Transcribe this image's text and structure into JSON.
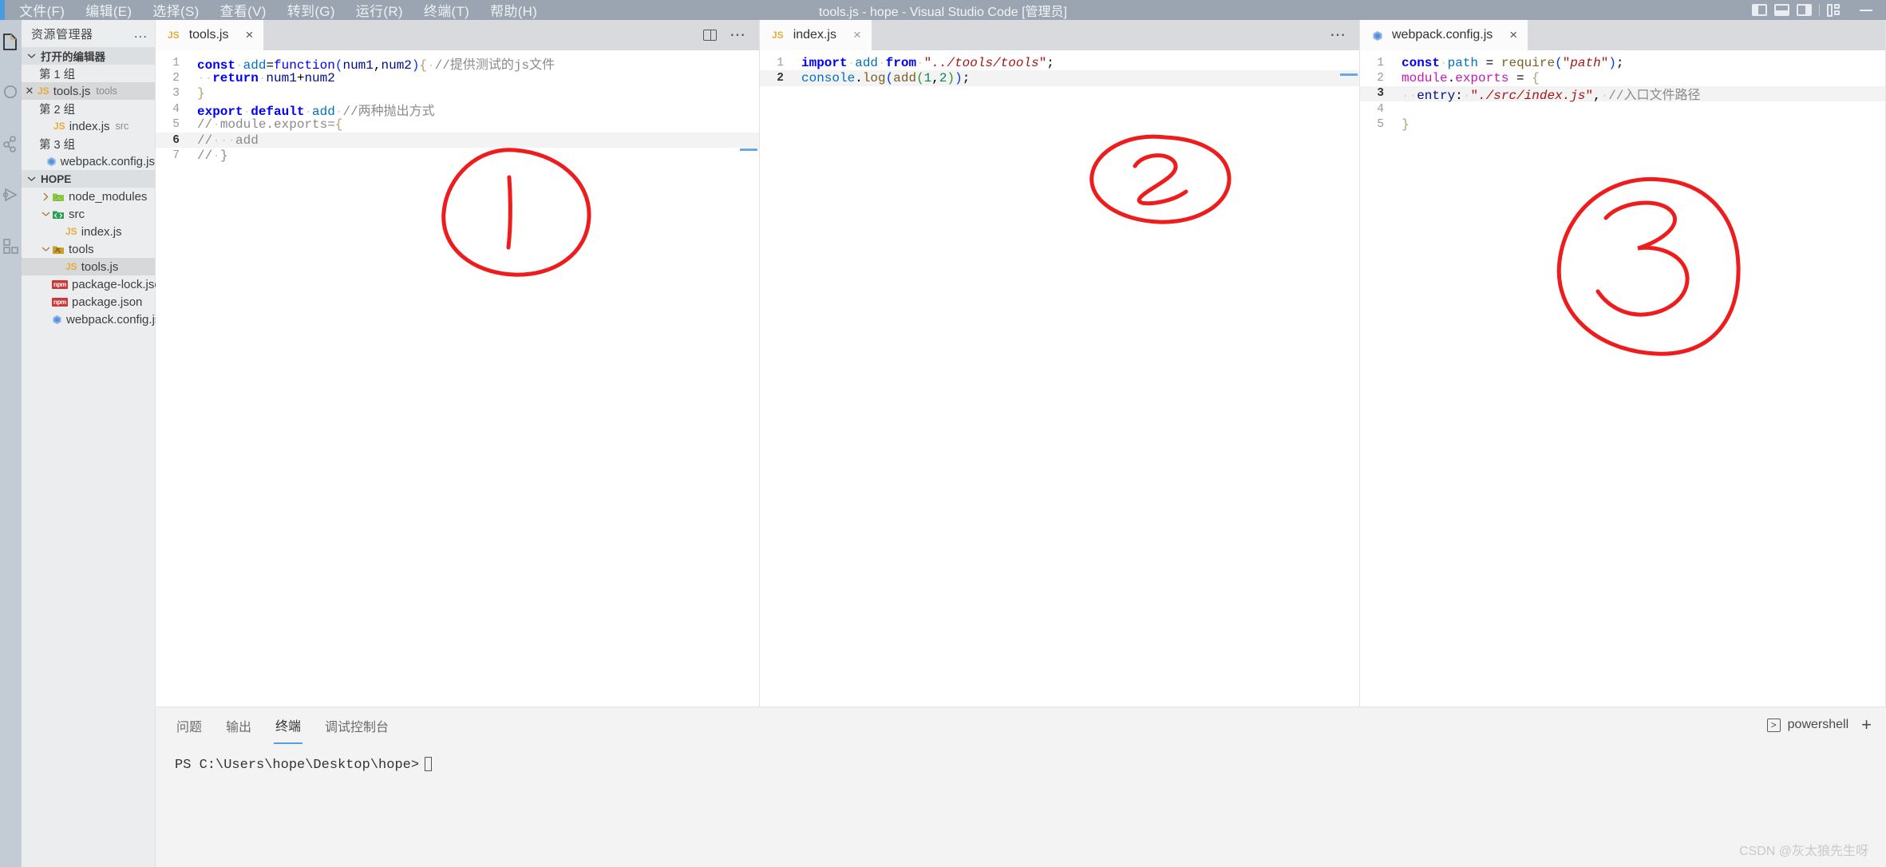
{
  "titlebar": {
    "menus": [
      "文件(F)",
      "编辑(E)",
      "选择(S)",
      "查看(V)",
      "转到(G)",
      "运行(R)",
      "终端(T)",
      "帮助(H)"
    ],
    "title": "tools.js - hope - Visual Studio Code [管理员]",
    "accent_color": "#4a9ae0",
    "background_color": "#9aa5b1"
  },
  "activitybar": {
    "items": [
      {
        "name": "explorer-icon",
        "label": "资源管理器"
      },
      {
        "name": "search-icon",
        "label": "搜索"
      },
      {
        "name": "source-control-icon",
        "label": "源代码管理"
      },
      {
        "name": "run-debug-icon",
        "label": "运行和调试"
      },
      {
        "name": "extensions-icon",
        "label": "扩展"
      }
    ]
  },
  "sidebar": {
    "title": "资源管理器",
    "more_actions": "...",
    "open_editors": {
      "header": "打开的编辑器",
      "groups": [
        {
          "label": "第 1 组",
          "files": [
            {
              "name": "tools.js",
              "desc": "tools",
              "icon": "js",
              "has_close": true,
              "selected": true
            }
          ]
        },
        {
          "label": "第 2 组",
          "files": [
            {
              "name": "index.js",
              "desc": "src",
              "icon": "js",
              "has_close": false,
              "selected": false
            }
          ]
        },
        {
          "label": "第 3 组",
          "files": [
            {
              "name": "webpack.config.js",
              "desc": "",
              "icon": "webpack",
              "has_close": false,
              "selected": false
            }
          ]
        }
      ]
    },
    "workspace": {
      "header": "HOPE",
      "tree": [
        {
          "label": "node_modules",
          "icon": "folder-node",
          "depth": 1,
          "expanded": false,
          "type": "folder"
        },
        {
          "label": "src",
          "icon": "folder-src",
          "depth": 1,
          "expanded": true,
          "type": "folder"
        },
        {
          "label": "index.js",
          "icon": "js",
          "depth": 2,
          "type": "file"
        },
        {
          "label": "tools",
          "icon": "folder-tools",
          "depth": 1,
          "expanded": true,
          "type": "folder"
        },
        {
          "label": "tools.js",
          "icon": "js",
          "depth": 2,
          "type": "file",
          "selected": true
        },
        {
          "label": "package-lock.json",
          "icon": "npm",
          "depth": 1,
          "type": "file"
        },
        {
          "label": "package.json",
          "icon": "npm",
          "depth": 1,
          "type": "file"
        },
        {
          "label": "webpack.config.js",
          "icon": "webpack",
          "depth": 1,
          "type": "file"
        }
      ]
    }
  },
  "editor_groups": [
    {
      "tab": {
        "label": "tools.js",
        "icon": "js",
        "close": "×"
      },
      "actions": [
        "split-editor-icon",
        "more-actions-icon"
      ],
      "active_line": 6,
      "lines": [
        {
          "n": 1,
          "tokens": [
            {
              "t": "const",
              "c": "ctl"
            },
            {
              "t": "·",
              "c": "ws"
            },
            {
              "t": "add",
              "c": "varb"
            },
            {
              "t": "=",
              "c": "plain"
            },
            {
              "t": "function",
              "c": "fn"
            },
            {
              "t": "(",
              "c": "p1"
            },
            {
              "t": "num1",
              "c": "var"
            },
            {
              "t": ",",
              "c": "plain"
            },
            {
              "t": "num2",
              "c": "var"
            },
            {
              "t": ")",
              "c": "p1"
            },
            {
              "t": "{",
              "c": "brc"
            },
            {
              "t": "·",
              "c": "ws"
            },
            {
              "t": "//提供测试的js文件",
              "c": "cmt"
            }
          ]
        },
        {
          "n": 2,
          "tokens": [
            {
              "t": "··",
              "c": "ws"
            },
            {
              "t": "return",
              "c": "ctl"
            },
            {
              "t": "·",
              "c": "ws"
            },
            {
              "t": "num1",
              "c": "var"
            },
            {
              "t": "+",
              "c": "plain"
            },
            {
              "t": "num2",
              "c": "var"
            }
          ]
        },
        {
          "n": 3,
          "tokens": [
            {
              "t": "}",
              "c": "brc"
            }
          ]
        },
        {
          "n": 4,
          "tokens": [
            {
              "t": "export",
              "c": "ctl"
            },
            {
              "t": "·",
              "c": "ws"
            },
            {
              "t": "default",
              "c": "ctl"
            },
            {
              "t": "·",
              "c": "ws"
            },
            {
              "t": "add",
              "c": "varb"
            },
            {
              "t": "·",
              "c": "ws"
            },
            {
              "t": "//两种抛出方式",
              "c": "cmt"
            }
          ]
        },
        {
          "n": 5,
          "tokens": [
            {
              "t": "//·module.exports={",
              "c": "cmt"
            }
          ]
        },
        {
          "n": 6,
          "tokens": [
            {
              "t": "//···add",
              "c": "cmt"
            }
          ]
        },
        {
          "n": 7,
          "tokens": [
            {
              "t": "//·}",
              "c": "cmt"
            }
          ]
        }
      ]
    },
    {
      "tab": {
        "label": "index.js",
        "icon": "js",
        "close": "×"
      },
      "actions": [
        "more-actions-icon"
      ],
      "active_line": 2,
      "lines": [
        {
          "n": 1,
          "tokens": [
            {
              "t": "import",
              "c": "ctl"
            },
            {
              "t": "·",
              "c": "ws"
            },
            {
              "t": "add",
              "c": "varb"
            },
            {
              "t": "·",
              "c": "ws"
            },
            {
              "t": "from",
              "c": "ctl"
            },
            {
              "t": "·",
              "c": "ws"
            },
            {
              "t": "\"",
              "c": "str"
            },
            {
              "t": "../tools/tools",
              "c": "strb"
            },
            {
              "t": "\";",
              "c": "str"
            }
          ]
        },
        {
          "n": 2,
          "tokens": [
            {
              "t": "console",
              "c": "varb"
            },
            {
              "t": ".",
              "c": "plain"
            },
            {
              "t": "log",
              "c": "call"
            },
            {
              "t": "(",
              "c": "p1"
            },
            {
              "t": "add",
              "c": "call"
            },
            {
              "t": "(",
              "c": "p2"
            },
            {
              "t": "1",
              "c": "num"
            },
            {
              "t": ",",
              "c": "plain"
            },
            {
              "t": "2",
              "c": "num"
            },
            {
              "t": ")",
              "c": "p2"
            },
            {
              "t": ")",
              "c": "p1"
            },
            {
              "t": ";",
              "c": "plain"
            }
          ]
        }
      ]
    },
    {
      "tab": {
        "label": "webpack.config.js",
        "icon": "webpack",
        "close": "×"
      },
      "actions": [],
      "active_line": 3,
      "lines": [
        {
          "n": 1,
          "tokens": [
            {
              "t": "const",
              "c": "ctl"
            },
            {
              "t": "·",
              "c": "ws"
            },
            {
              "t": "path",
              "c": "varb"
            },
            {
              "t": "·=·",
              "c": "plain"
            },
            {
              "t": "require",
              "c": "call"
            },
            {
              "t": "(",
              "c": "p1"
            },
            {
              "t": "\"",
              "c": "str"
            },
            {
              "t": "path",
              "c": "strb"
            },
            {
              "t": "\"",
              "c": "str"
            },
            {
              "t": ")",
              "c": "p1"
            },
            {
              "t": ";",
              "c": "plain"
            }
          ]
        },
        {
          "n": 2,
          "tokens": [
            {
              "t": "module",
              "c": "prop"
            },
            {
              "t": ".",
              "c": "plain"
            },
            {
              "t": "exports",
              "c": "prop"
            },
            {
              "t": "·=·",
              "c": "plain"
            },
            {
              "t": "{",
              "c": "brc"
            }
          ]
        },
        {
          "n": 3,
          "tokens": [
            {
              "t": "··",
              "c": "ws"
            },
            {
              "t": "entry",
              "c": "var"
            },
            {
              "t": ":·",
              "c": "plain"
            },
            {
              "t": "\"",
              "c": "str"
            },
            {
              "t": "./src/index.js",
              "c": "strb"
            },
            {
              "t": "\"",
              "c": "str"
            },
            {
              "t": ",",
              "c": "plain"
            },
            {
              "t": "·",
              "c": "ws"
            },
            {
              "t": "//入口文件路径",
              "c": "cmt"
            }
          ]
        },
        {
          "n": 4,
          "tokens": []
        },
        {
          "n": 5,
          "tokens": [
            {
              "t": "}",
              "c": "brc"
            }
          ]
        }
      ]
    }
  ],
  "annotations": [
    {
      "name": "annotation-1",
      "text": "1",
      "color": "#ee1c1c"
    },
    {
      "name": "annotation-2",
      "text": "2",
      "color": "#ee1c1c"
    },
    {
      "name": "annotation-3",
      "text": "3",
      "color": "#ee1c1c"
    }
  ],
  "panel": {
    "tabs": [
      {
        "label": "问题",
        "active": false
      },
      {
        "label": "输出",
        "active": false
      },
      {
        "label": "终端",
        "active": true
      },
      {
        "label": "调试控制台",
        "active": false
      }
    ],
    "terminal_name": "powershell",
    "new_terminal_label": "+",
    "prompt": "PS C:\\Users\\hope\\Desktop\\hope>"
  },
  "watermark": "CSDN @灰太狼先生呀"
}
